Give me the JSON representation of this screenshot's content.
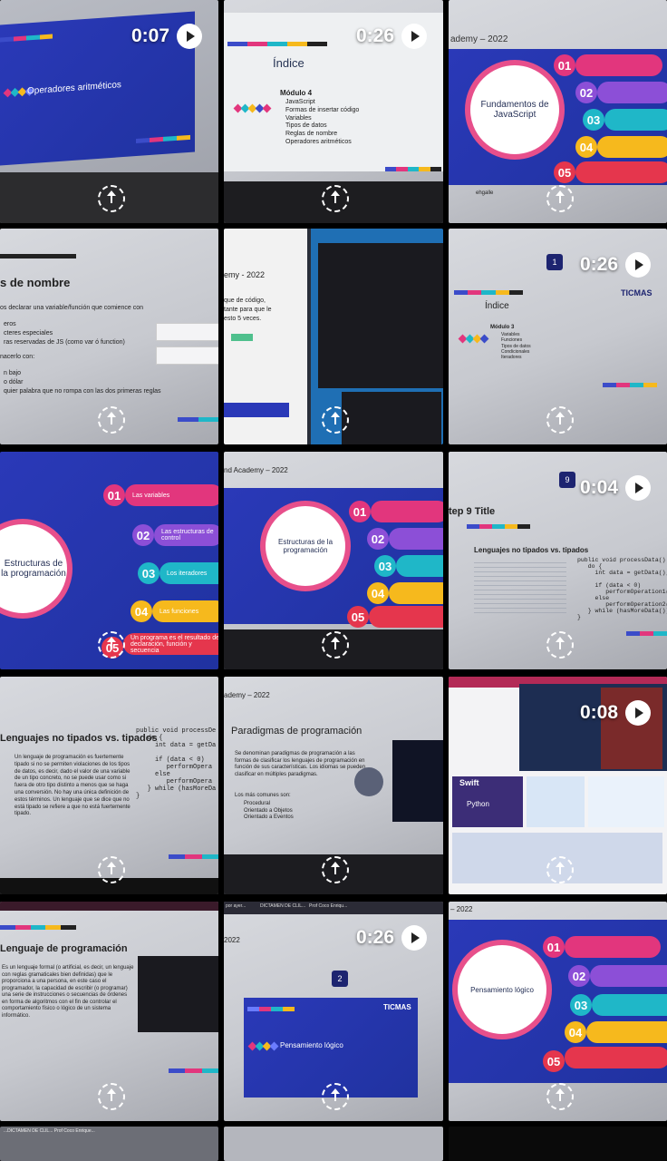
{
  "tiles": [
    {
      "duration": "0:07",
      "slide_title": "Operadores aritméticos"
    },
    {
      "duration": "0:26",
      "slide_title": "Índice",
      "module": "Módulo 4",
      "items": [
        "JavaScript",
        "Formas de insertar código",
        "Variables",
        "Tipos de datos",
        "Reglas de nombre",
        "Operadores aritméticos"
      ]
    },
    {
      "header": "ademy – 2022",
      "slide_title": "Fundamentos de JavaScript",
      "footer": "ehgalle",
      "numbers": [
        "01",
        "02",
        "03",
        "04",
        "05"
      ]
    },
    {
      "slide_title": "s de nombre",
      "lines": [
        "os declarar una variable/función que comience con",
        "eros",
        "cteres especiales",
        "ras reservadas de JS (como var ó function)",
        "nacerlo con:",
        "n bajo",
        "o dólar",
        "quier palabra que no rompa con las dos primeras reglas"
      ]
    },
    {
      "header": "emy - 2022",
      "lines": [
        "que de código,",
        "tante para que le",
        "esto 5 veces."
      ]
    },
    {
      "duration": "0:26",
      "badge": "1",
      "brand": "TICMAS",
      "slide_title": "Índice",
      "module": "Módulo 3",
      "items": [
        "Variables",
        "Funciones",
        "Tipos de datos",
        "Condicionales",
        "Iteradores"
      ]
    },
    {
      "slide_title": "Estructuras de la programación",
      "numbers": [
        "01",
        "02",
        "03",
        "04",
        "05"
      ],
      "lines": [
        "Las variables",
        "Las estructuras de control",
        "Los iteradores",
        "Las funciones",
        "Un programa es el resultado de declaración, función y secuencia"
      ]
    },
    {
      "header": "nd Academy – 2022",
      "slide_title": "Estructuras de la programación",
      "numbers": [
        "01",
        "02",
        "03",
        "04",
        "05"
      ]
    },
    {
      "duration": "0:04",
      "badge": "9",
      "step_title": "tep 9 Title",
      "slide_title": "Lenguajes no tipados vs. tipados",
      "code": "public void processData() {\n   do {\n     int data = getData();\n\n     if (data < 0)\n        performOperation1(data);\n     else\n        performOperation2(data);\n   } while (hasMoreData());\n}"
    },
    {
      "slide_title": "Lenguajes no tipados vs. tipados",
      "body": "Un lenguaje de programación es fuertemente tipado si no se permiten violaciones de los tipos de datos, es decir, dado el valor de una variable de un tipo concreto, no se puede usar como si fuera de otro tipo distinto a menos que se haga una conversión. No hay una única definición de estos términos. Un lenguaje que se dice que no está tipado se refiere a que no está fuertemente tipado.",
      "code": "public void processDe\n   do {\n     int data = getDa\n\n     if (data < 0)\n        performOpera\n     else\n        performOpera\n   } while (hasMoreDa\n}"
    },
    {
      "header": "ademy – 2022",
      "slide_title": "Paradigmas de programación",
      "body": "Se denominan paradigmas de programación a las formas de clasificar los lenguajes de programación en función de sus características. Los idiomas se pueden clasificar en múltiples paradigmas.",
      "list_intro": "Los más comunes son:",
      "items": [
        "Procedural",
        "Orientado a Objetos",
        "Orientado a Eventos"
      ]
    },
    {
      "duration": "0:08",
      "labels": [
        "Swift",
        "Python"
      ]
    },
    {
      "slide_title": "Lenguaje de programación",
      "body": "Es un lenguaje formal (o artificial, es decir, un lenguaje con reglas gramaticales bien definidas) que le proporciona a una persona, en este caso el programador, la capacidad de escribir (o programar) una serie de instrucciones o secuencias de órdenes en forma de algoritmos con el fin de controlar el comportamiento físico o lógico de un sistema informático."
    },
    {
      "duration": "0:26",
      "header": "2022",
      "badge": "2",
      "brand": "TICMAS",
      "slide_title": "Pensamiento lógico",
      "tabs": [
        "por ayer...",
        "DICTAMEN DE CLIL...",
        "Prof Coco Enriqu..."
      ]
    },
    {
      "header": "– 2022",
      "slide_title": "Pensamiento lógico",
      "numbers": [
        "01",
        "02",
        "03",
        "04",
        "05"
      ]
    },
    {
      "bottom": "...DICTAMEN DE CLIL... Prof Coco Enrique..."
    }
  ],
  "colors": {
    "blue": "#2a39b8",
    "pink": "#e2367d",
    "cyan": "#1fb7c8",
    "yellow": "#f6b91d",
    "orange": "#ef7a2a",
    "red": "#e5364d",
    "purple": "#8c4fd7"
  }
}
